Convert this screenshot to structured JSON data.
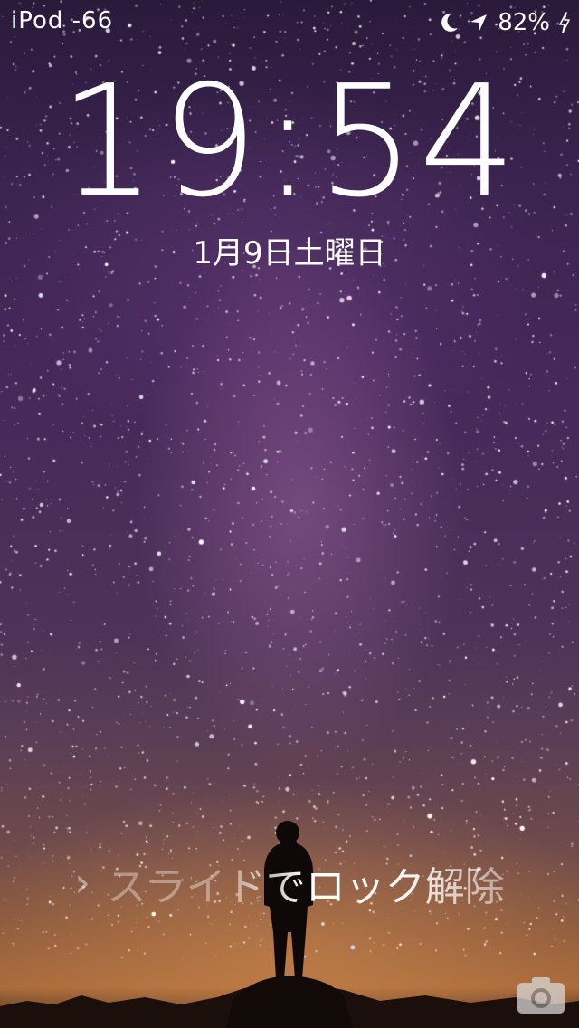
{
  "status_bar": {
    "carrier": "iPod -66",
    "battery": "82%",
    "icons": [
      "moon-icon",
      "location-arrow-icon",
      "charging-bolt-icon"
    ]
  },
  "lock_screen": {
    "time": "19:54",
    "date": "1月9日土曜日",
    "slide_label": "スライドでロック解除",
    "camera_icon": "camera-icon"
  },
  "colors": {
    "text": "#ffffff",
    "sky_top": "#2a1a3a",
    "sky_mid": "#4a2d59",
    "horizon": "#a8693a"
  }
}
